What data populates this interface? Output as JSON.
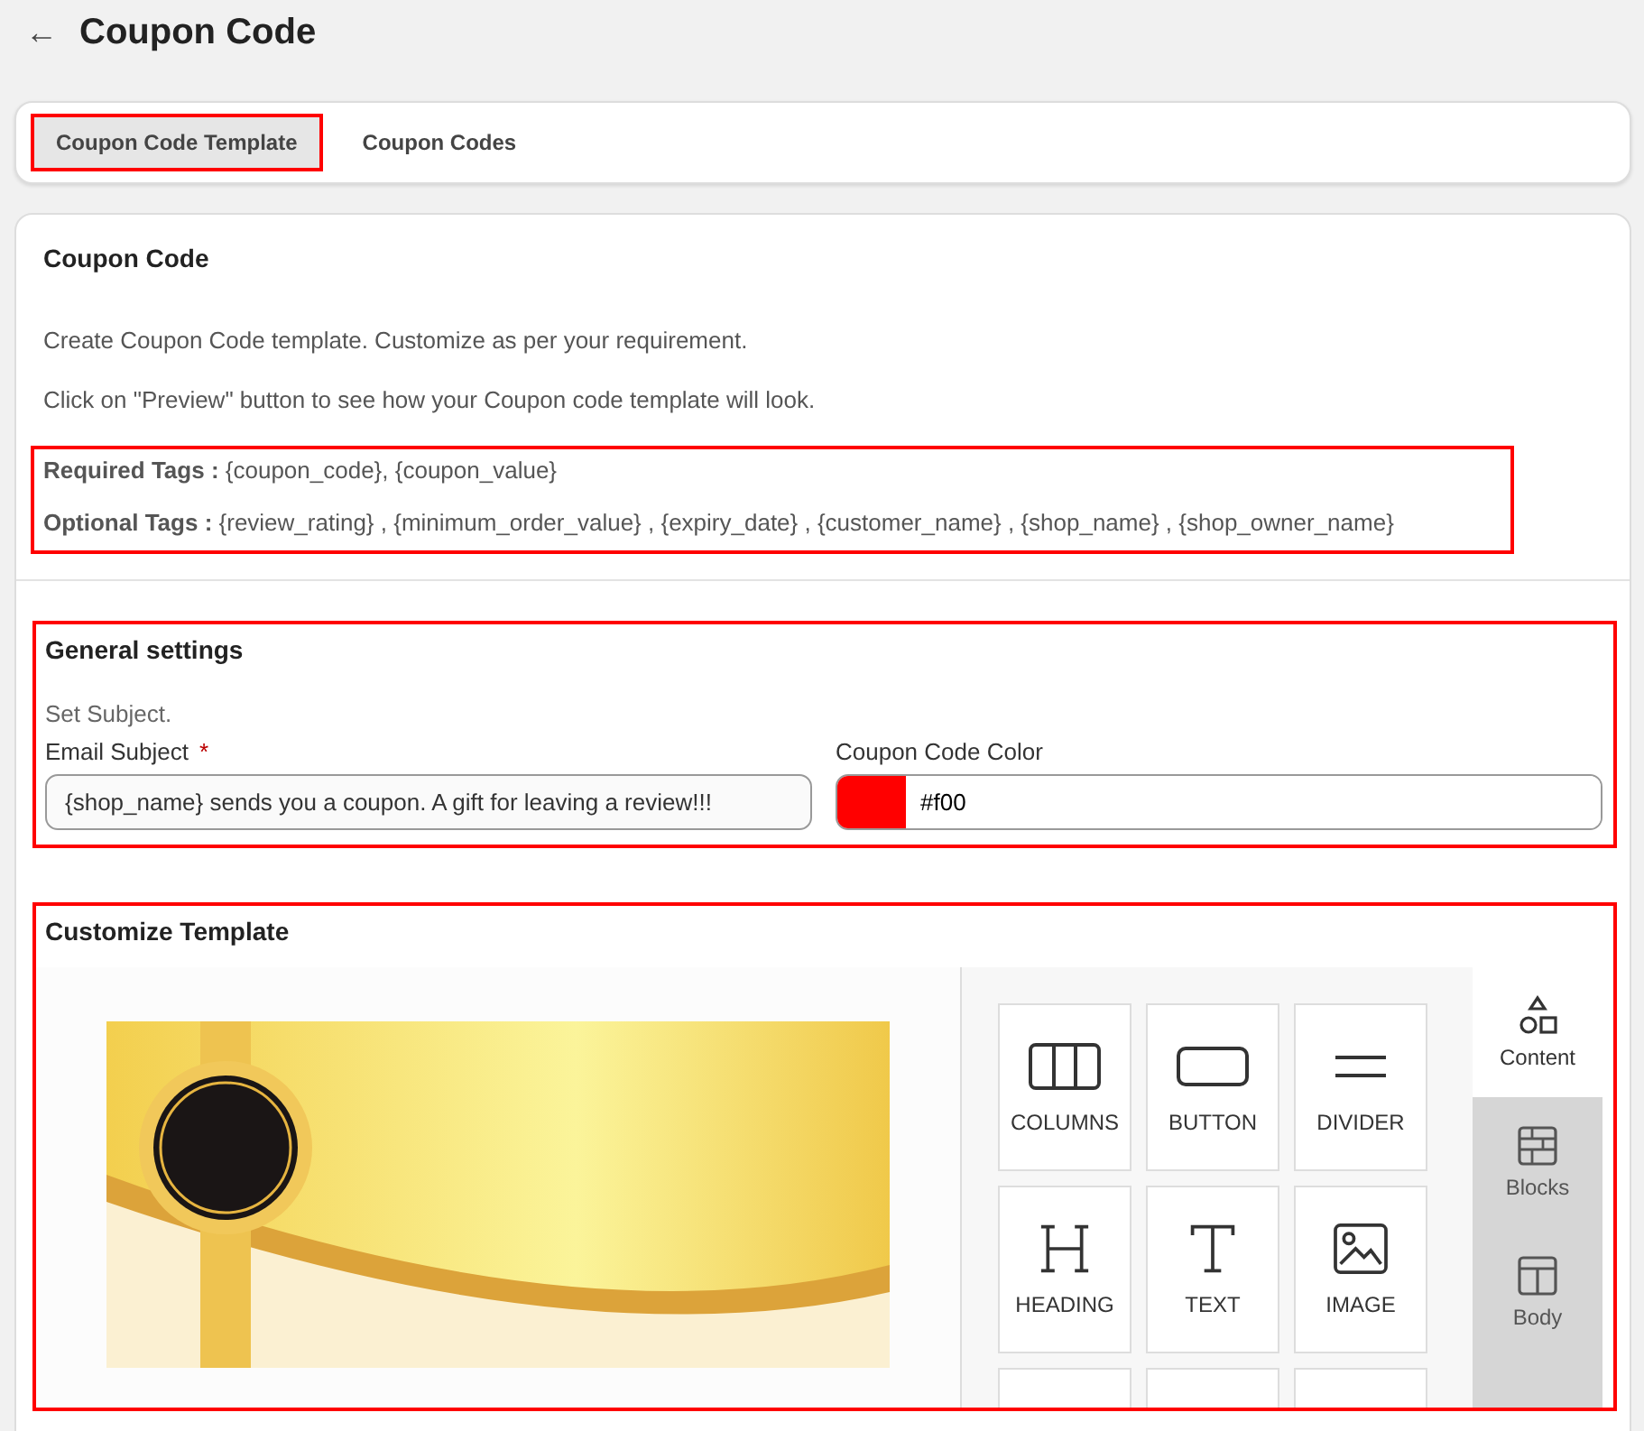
{
  "header": {
    "back": "←",
    "title": "Coupon Code"
  },
  "tabs": [
    {
      "label": "Coupon Code Template",
      "selected": true,
      "highlighted": true
    },
    {
      "label": "Coupon Codes",
      "selected": false,
      "highlighted": false
    }
  ],
  "intro": {
    "title": "Coupon Code",
    "lines": [
      "Create Coupon Code template. Customize as per your requirement.",
      "Click on \"Preview\" button to see how your Coupon code template will look."
    ],
    "tags": {
      "highlighted": true,
      "items": [
        {
          "label": "Required Tags :",
          "value": "{coupon_code}, {coupon_value}"
        },
        {
          "label": "Optional Tags :",
          "value": "{review_rating} , {minimum_order_value} , {expiry_date} , {customer_name} , {shop_name} , {shop_owner_name}"
        }
      ]
    }
  },
  "general_settings": {
    "highlighted": true,
    "title": "General settings",
    "subtitle": "Set Subject.",
    "subject": {
      "label": "Email Subject",
      "required_mark": "*",
      "value": "{shop_name} sends you a coupon. A gift for leaving a review!!!"
    },
    "color_field": {
      "label": "Coupon Code Color",
      "color": "#ff0000",
      "value": "#f00"
    }
  },
  "customize_template": {
    "highlighted": true,
    "title": "Customize Template",
    "tools": [
      {
        "kind": "columns",
        "label": "COLUMNS"
      },
      {
        "kind": "button",
        "label": "BUTTON"
      },
      {
        "kind": "divider",
        "label": "DIVIDER"
      },
      {
        "kind": "heading",
        "label": "HEADING"
      },
      {
        "kind": "text",
        "label": "TEXT"
      },
      {
        "kind": "image",
        "label": "IMAGE"
      }
    ],
    "side_tabs": [
      {
        "kind": "content",
        "label": "Content",
        "selected": true
      },
      {
        "kind": "blocks",
        "label": "Blocks",
        "selected": false
      },
      {
        "kind": "body",
        "label": "Body",
        "selected": false
      }
    ]
  }
}
